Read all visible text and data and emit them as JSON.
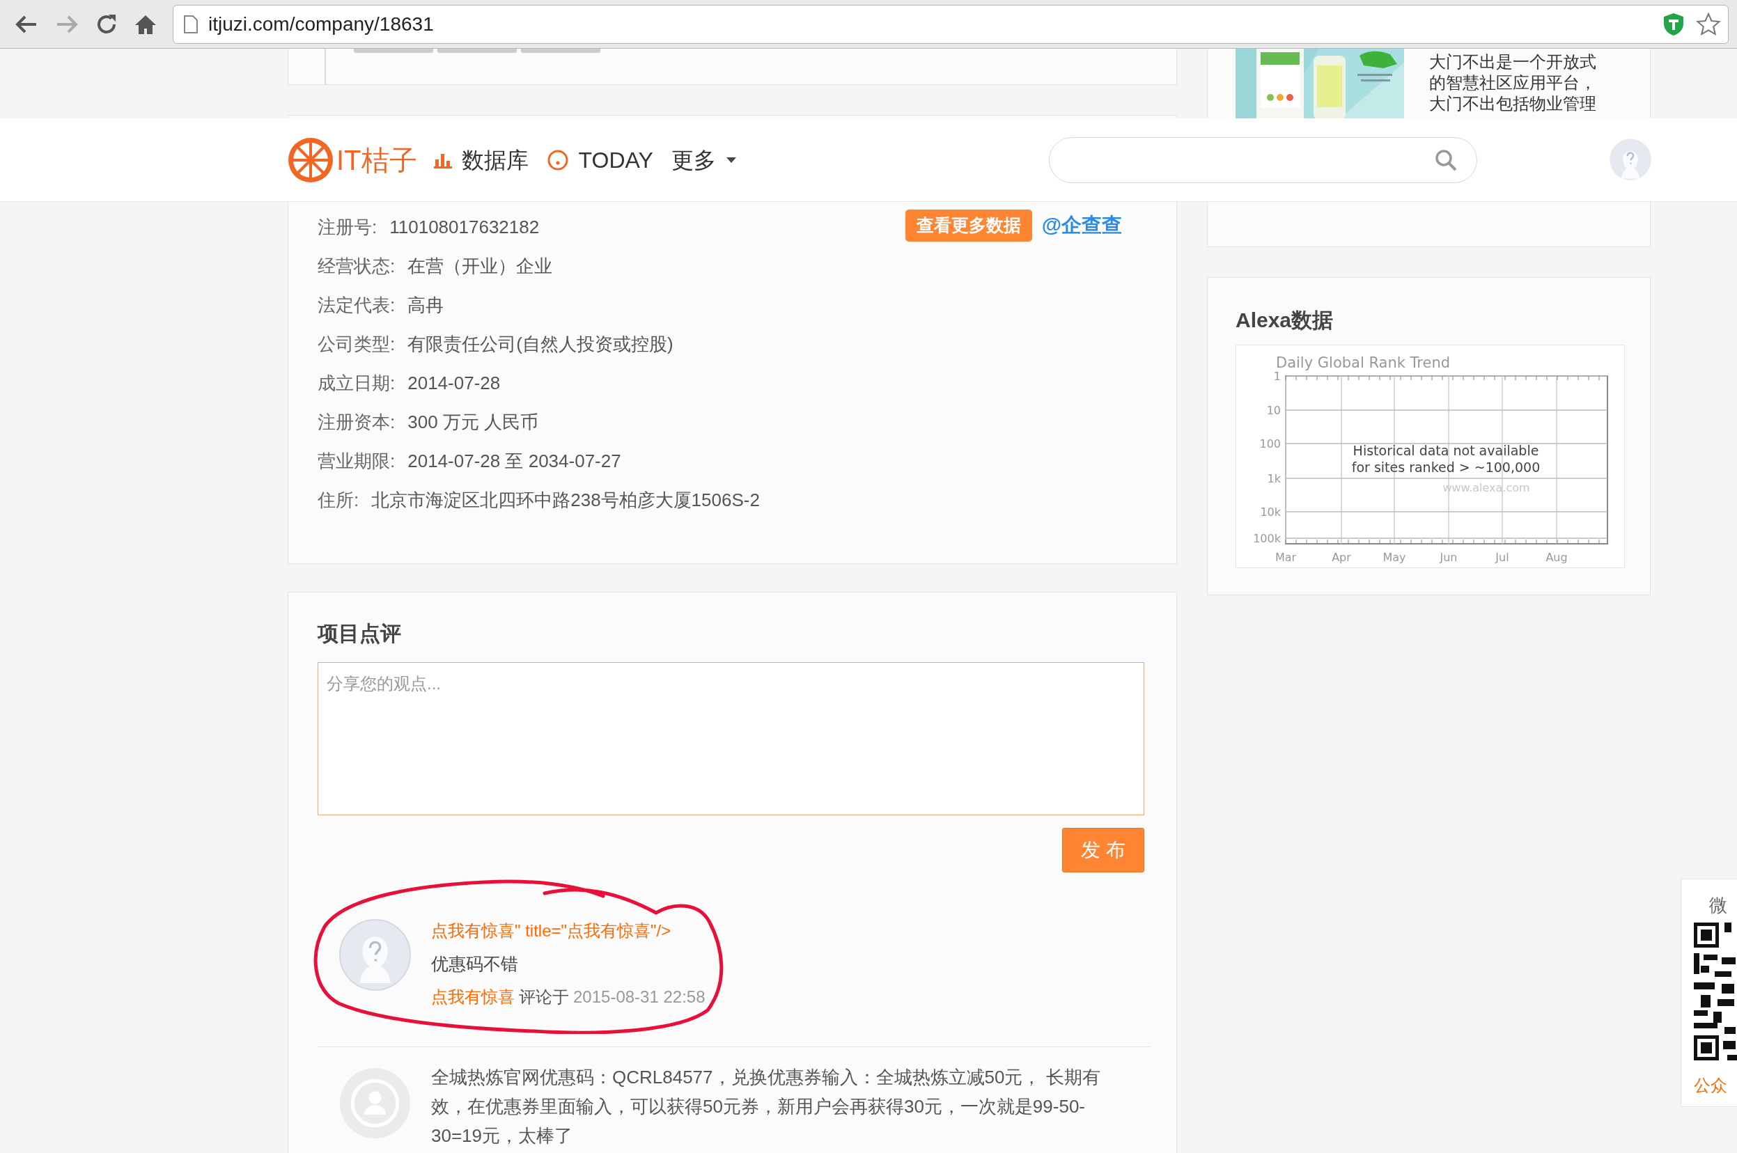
{
  "browser": {
    "url": "itjuzi.com/company/18631"
  },
  "nav": {
    "logo": "IT桔子",
    "items": [
      {
        "kind": "bars",
        "label": "数据库"
      },
      {
        "kind": "ring",
        "label": "TODAY"
      },
      {
        "kind": "caret",
        "label": "更多"
      }
    ]
  },
  "company_intro": {
    "lines": [
      "大门不出是一个开放式",
      "的智慧社区应用平台，",
      "大门不出包括物业管理"
    ]
  },
  "business_info": {
    "more_button": "查看更多数据",
    "source_link": "@企查查",
    "fields": [
      {
        "label": "注册号:",
        "value": "110108017632182"
      },
      {
        "label": "经营状态:",
        "value": "在营（开业）企业"
      },
      {
        "label": "法定代表:",
        "value": "高冉"
      },
      {
        "label": "公司类型:",
        "value": "有限责任公司(自然人投资或控股)"
      },
      {
        "label": "成立日期:",
        "value": "2014-07-28"
      },
      {
        "label": "注册资本:",
        "value": "300 万元 人民币"
      },
      {
        "label": "营业期限:",
        "value": "2014-07-28 至 2034-07-27"
      },
      {
        "label": "住所:",
        "value": "北京市海淀区北四环中路238号柏彦大厦1506S-2"
      }
    ]
  },
  "alexa": {
    "title": "Alexa数据",
    "chart_title": "Daily Global Rank Trend",
    "y_ticks": [
      "1",
      "10",
      "100",
      "1k",
      "10k",
      "100k"
    ],
    "x_ticks": [
      "Mar",
      "Apr",
      "May",
      "Jun",
      "Jul",
      "Aug"
    ],
    "message": [
      "Historical data not available",
      "for sites ranked > ~100,000"
    ],
    "watermark": "www.alexa.com"
  },
  "reviews": {
    "title": "项目点评",
    "placeholder": "分享您的观点...",
    "submit": "发 布",
    "comments": [
      {
        "kind": "question",
        "circled": true,
        "title": "点我有惊喜\" title=\"点我有惊喜\"/>",
        "body": "优惠码不错",
        "author": "点我有惊喜",
        "verb": "评论于",
        "time": "2015-08-31 22:58"
      },
      {
        "kind": "person",
        "circled": false,
        "body": "全城热炼官网优惠码：QCRL84577，兑换优惠券输入：全城热炼立减50元， 长期有效，在优惠券里面输入，可以获得50元券，新用户会再获得30元，一次就是99-50-30=19元，太棒了"
      }
    ]
  },
  "qr_widget": {
    "heading": "微",
    "caption": "公众"
  }
}
